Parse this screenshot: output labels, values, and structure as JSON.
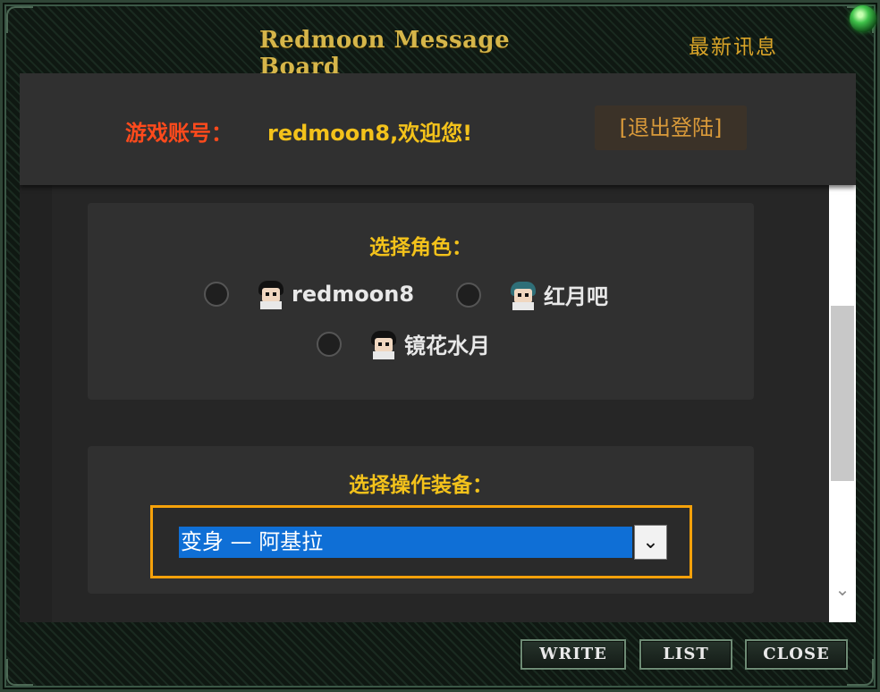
{
  "window": {
    "title": "Redmoon Message Board",
    "latest_link": "最新讯息",
    "status_orb_color": "#3fc24a"
  },
  "header": {
    "account_label": "游戏账号：",
    "welcome_text": "redmoon8,欢迎您!",
    "logout_label": "[退出登陆]"
  },
  "role_section": {
    "title": "选择角色：",
    "roles": [
      {
        "name": "redmoon8",
        "avatar_icon": "character-avatar-icon",
        "selected": false
      },
      {
        "name": "红月吧",
        "avatar_icon": "character-avatar-icon",
        "selected": false
      },
      {
        "name": "镜花水月",
        "avatar_icon": "character-avatar-icon",
        "selected": false
      }
    ]
  },
  "equip_section": {
    "title": "选择操作装备：",
    "selected_value": "变身 — 阿基拉",
    "dropdown_icon": "chevron-down-icon"
  },
  "footer": {
    "write_label": "WRITE",
    "list_label": "LIST",
    "close_label": "CLOSE"
  },
  "colors": {
    "gold": "#f3c21b",
    "account_label": "#ff4a1c",
    "select_highlight": "#0f6fd6",
    "select_border": "#f5a10a"
  }
}
